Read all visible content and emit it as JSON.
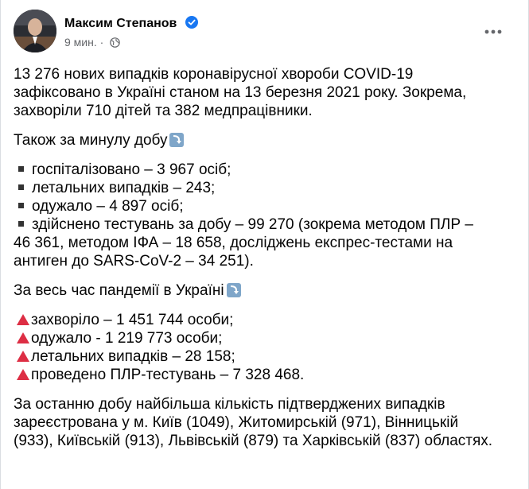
{
  "header": {
    "author": "Максим Степанов",
    "time": "9 мин.",
    "dot": "·"
  },
  "post": {
    "p1": [
      "13 276 нових випадків коронавірусної хвороби COVID-19",
      "зафіксовано в Україні станом на 13 березня 2021 року. Зокрема,",
      "захворіли 710 дітей та 382 медпрацівники."
    ],
    "daily_title": "Також за минулу добу",
    "daily_items": [
      "госпіталізовано – 3 967 осіб;",
      "летальних випадків – 243;",
      "одужало – 4 897 осіб;",
      "здійснено тестувань за добу – 99 270 (зокрема методом ПЛР –"
    ],
    "daily_cont": [
      "46 361, методом ІФА – 18 658, досліджень експрес-тестами на",
      "антиген до SARS-CoV-2 – 34 251)."
    ],
    "total_title": "За весь час пандемії в Україні",
    "total_items": [
      "захворіло – 1 451 744 особи;",
      "одужало - 1 219 773 особи;",
      "летальних випадків – 28 158;",
      "проведено ПЛР-тестувань – 7 328 468."
    ],
    "regions": [
      "За останню добу найбільша кількість підтверджених випадків",
      "зареєстрована у м. Київ (1049), Житомирській (971), Вінницькій",
      "(933), Київській (913), Львівській (879) та Харківській (837) областях."
    ]
  },
  "icons": {
    "verified": "verified-badge-icon",
    "globe": "globe-icon",
    "more": "more-options-icon",
    "down_arrow": "down-arrow-emoji-icon",
    "triangle": "red-triangle-emoji-icon",
    "bullet": "black-square-bullet-icon"
  },
  "colors": {
    "verified": "#1877f2",
    "triangle": "#dd2e44",
    "arrow_box": "#7fa6c9",
    "meta_text": "#65676b"
  }
}
